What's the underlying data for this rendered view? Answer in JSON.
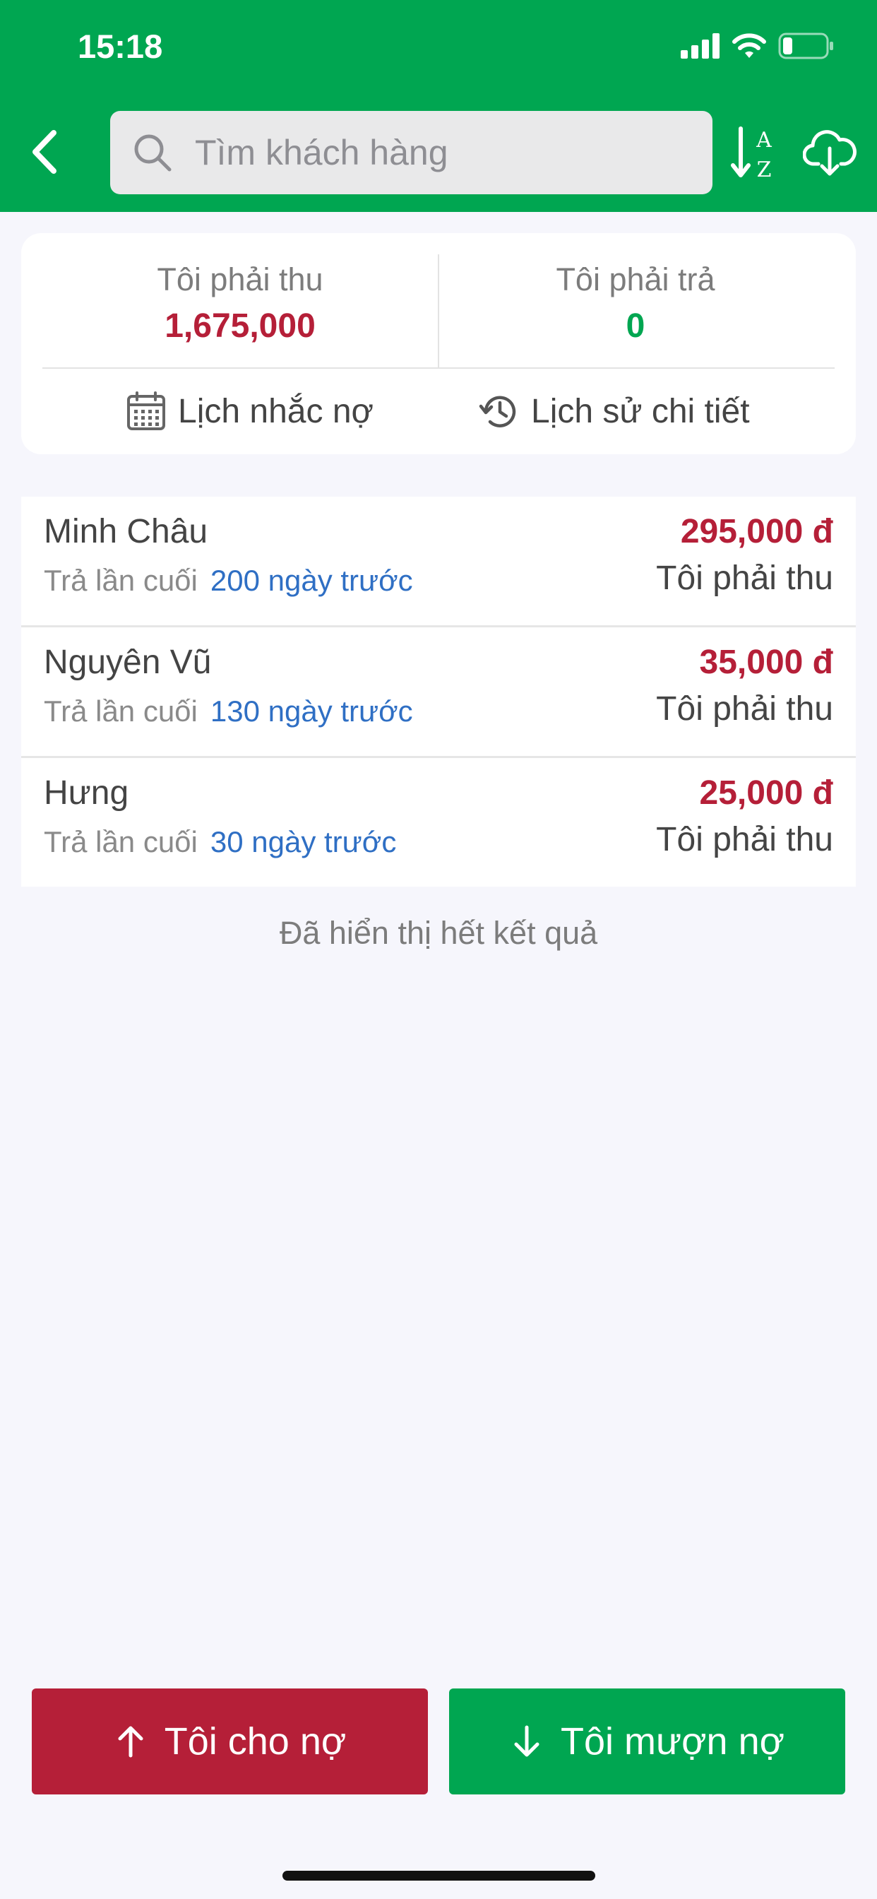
{
  "status_bar": {
    "time": "15:18"
  },
  "header": {
    "search_placeholder": "Tìm khách hàng",
    "icons": [
      "back-icon",
      "search-icon",
      "sort-az-icon",
      "cloud-download-icon"
    ]
  },
  "summary": {
    "receivable_label": "Tôi phải thu",
    "receivable_value": "1,675,000",
    "payable_label": "Tôi phải trả",
    "payable_value": "0",
    "reminder_label": "Lịch nhắc nợ",
    "history_label": "Lịch sử chi tiết"
  },
  "customers": [
    {
      "name": "Minh Châu",
      "last_paid_label": "Trả lần cuối",
      "last_paid": "200 ngày trước",
      "amount": "295,000 đ",
      "type": "Tôi phải thu"
    },
    {
      "name": "Nguyên Vũ",
      "last_paid_label": "Trả lần cuối",
      "last_paid": "130 ngày trước",
      "amount": "35,000 đ",
      "type": "Tôi phải thu"
    },
    {
      "name": "Hưng",
      "last_paid_label": "Trả lần cuối",
      "last_paid": "30 ngày trước",
      "amount": "25,000 đ",
      "type": "Tôi phải thu"
    }
  ],
  "end_message": "Đã hiển thị hết kết quả",
  "buttons": {
    "lend_label": "Tôi cho nợ",
    "borrow_label": "Tôi mượn nợ"
  },
  "colors": {
    "brand_green": "#00a651",
    "debt_red": "#b51f38",
    "link_blue": "#2f6fc4"
  }
}
